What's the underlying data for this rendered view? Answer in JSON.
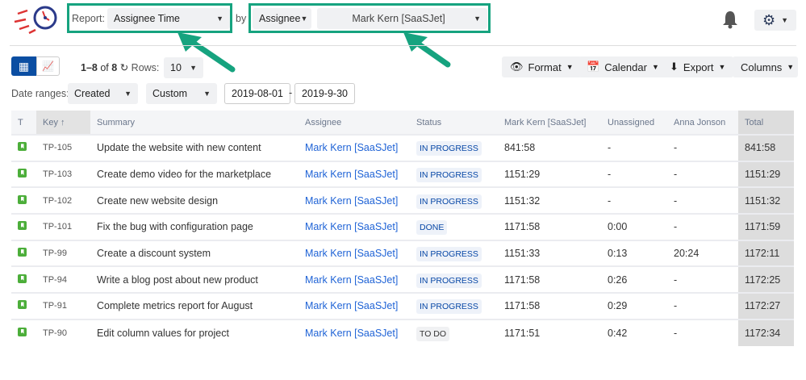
{
  "header": {
    "report_label": "Report:",
    "report_value": "Assignee Time",
    "by_label": "by",
    "group_value": "Assignee",
    "user_value": "Mark Kern [SaaSJet]"
  },
  "toolbar": {
    "pagination_range": "1–8",
    "pagination_of": "of",
    "pagination_total": "8",
    "rows_label": "Rows:",
    "rows_value": "10",
    "format": "Format",
    "calendar": "Calendar",
    "export": "Export",
    "columns": "Columns"
  },
  "dates": {
    "label": "Date ranges:",
    "field": "Created",
    "range": "Custom",
    "from": "2019-08-01",
    "sep": "-",
    "to": "2019-9-30"
  },
  "table": {
    "headers": [
      "T",
      "Key ↑",
      "Summary",
      "Assignee",
      "Status",
      "Mark Kern [SaaSJet]",
      "Unassigned",
      "Anna Jonson",
      "Total"
    ],
    "rows": [
      {
        "key": "TP-105",
        "summary": "Update the website with new content",
        "assignee": "Mark Kern [SaaSJet]",
        "status": "IN PROGRESS",
        "mark": "841:58",
        "unassigned": "-",
        "anna": "-",
        "total": "841:58"
      },
      {
        "key": "TP-103",
        "summary": "Create demo video for the marketplace",
        "assignee": "Mark Kern [SaaSJet]",
        "status": "IN PROGRESS",
        "mark": "1151:29",
        "unassigned": "-",
        "anna": "-",
        "total": "1151:29"
      },
      {
        "key": "TP-102",
        "summary": "Create new website design",
        "assignee": "Mark Kern [SaaSJet]",
        "status": "IN PROGRESS",
        "mark": "1151:32",
        "unassigned": "-",
        "anna": "-",
        "total": "1151:32"
      },
      {
        "key": "TP-101",
        "summary": "Fix the bug with configuration page",
        "assignee": "Mark Kern [SaaSJet]",
        "status": "DONE",
        "mark": "1171:58",
        "unassigned": "0:00",
        "anna": "-",
        "total": "1171:59"
      },
      {
        "key": "TP-99",
        "summary": "Create a discount system",
        "assignee": "Mark Kern [SaaSJet]",
        "status": "IN PROGRESS",
        "mark": "1151:33",
        "unassigned": "0:13",
        "anna": "20:24",
        "total": "1172:11"
      },
      {
        "key": "TP-94",
        "summary": "Write a blog post about new product",
        "assignee": "Mark Kern [SaaSJet]",
        "status": "IN PROGRESS",
        "mark": "1171:58",
        "unassigned": "0:26",
        "anna": "-",
        "total": "1172:25"
      },
      {
        "key": "TP-91",
        "summary": "Complete metrics report for August",
        "assignee": "Mark Kern [SaaSJet]",
        "status": "IN PROGRESS",
        "mark": "1171:58",
        "unassigned": "0:29",
        "anna": "-",
        "total": "1172:27"
      },
      {
        "key": "TP-90",
        "summary": "Edit column values for project",
        "assignee": "Mark Kern [SaaSJet]",
        "status": "TO DO",
        "mark": "1171:51",
        "unassigned": "0:42",
        "anna": "-",
        "total": "1172:34"
      }
    ]
  },
  "colors": {
    "highlight": "#16a37f",
    "link": "#1f63d6",
    "story": "#4cae3a"
  }
}
